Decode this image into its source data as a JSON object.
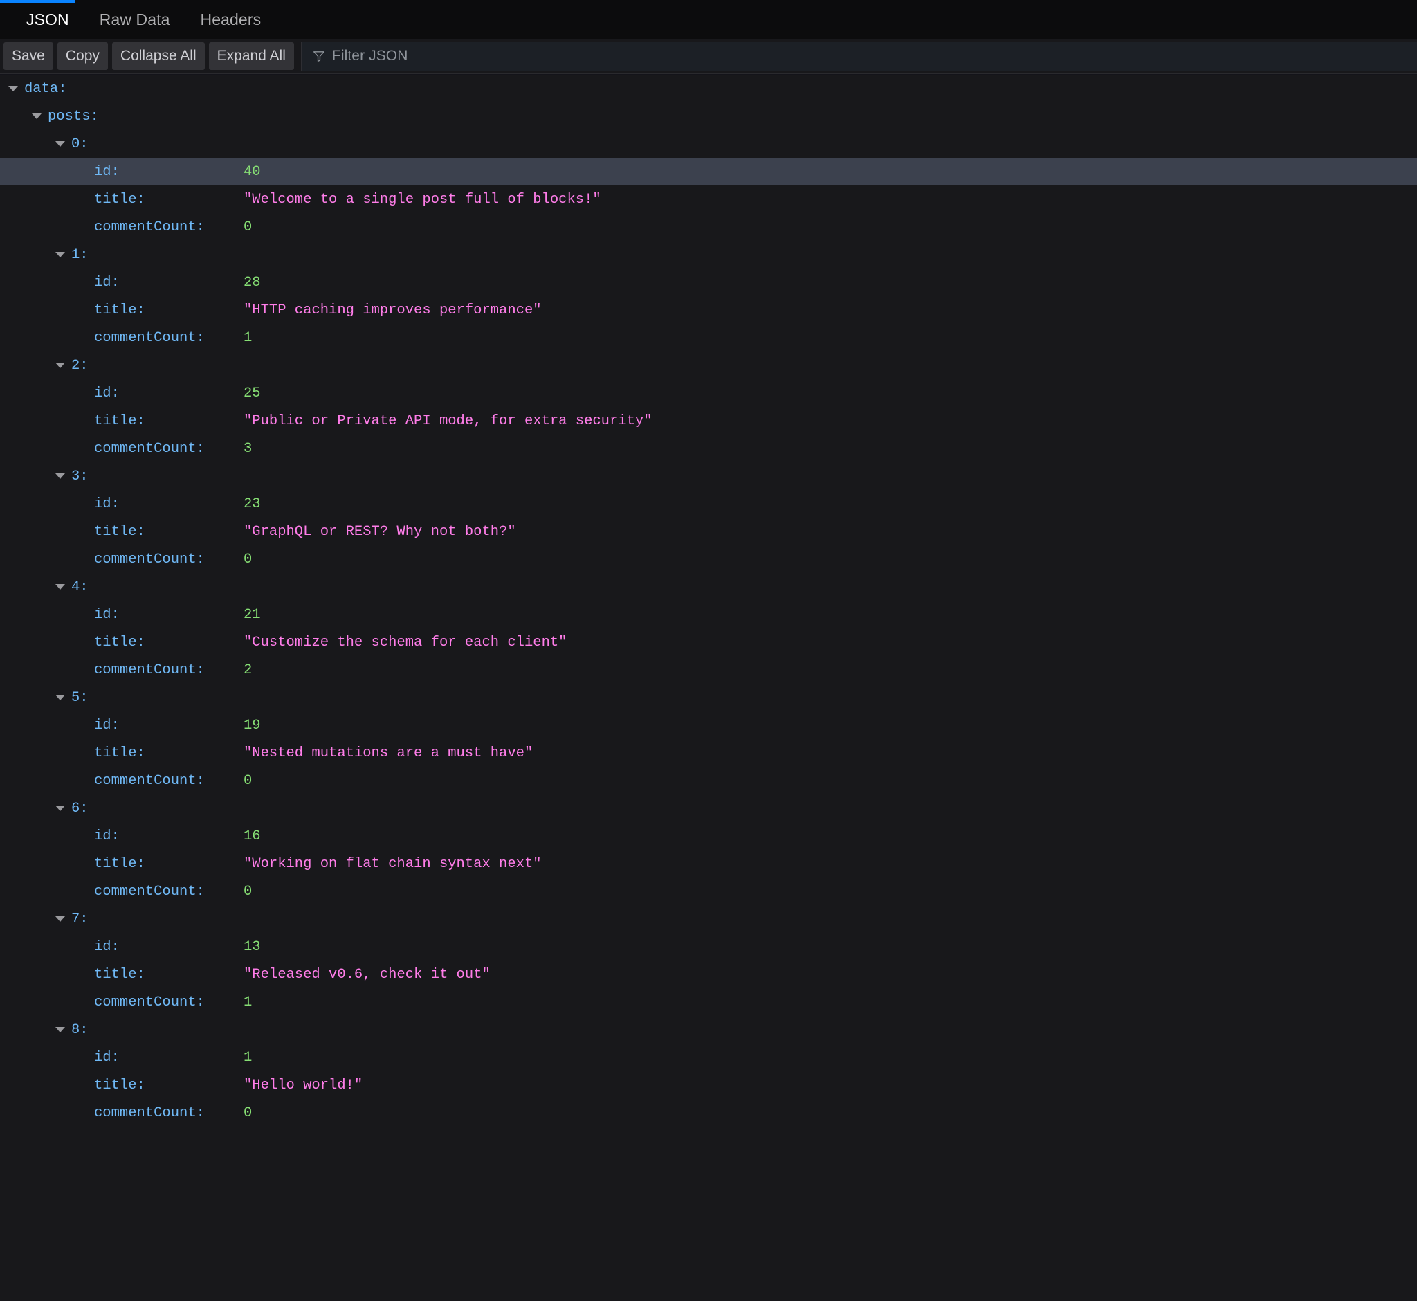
{
  "window": {
    "accent_color": "#0a84ff",
    "background": "#18181b"
  },
  "tabs": [
    {
      "label": "JSON",
      "active": true
    },
    {
      "label": "Raw Data",
      "active": false
    },
    {
      "label": "Headers",
      "active": false
    }
  ],
  "toolbar": {
    "save_label": "Save",
    "copy_label": "Copy",
    "collapse_all_label": "Collapse All",
    "expand_all_label": "Expand All",
    "filter_placeholder": "Filter JSON",
    "filter_icon": "filter-icon"
  },
  "json": {
    "root_key": "data:",
    "posts_key": "posts:",
    "keys": {
      "id": "id:",
      "title": "title:",
      "commentCount": "commentCount:"
    },
    "selected_row": "0.id",
    "posts": [
      {
        "index": "0:",
        "id": "40",
        "title": "\"Welcome to a single post full of blocks!\"",
        "commentCount": "0"
      },
      {
        "index": "1:",
        "id": "28",
        "title": "\"HTTP caching improves performance\"",
        "commentCount": "1"
      },
      {
        "index": "2:",
        "id": "25",
        "title": "\"Public or Private API mode, for extra security\"",
        "commentCount": "3"
      },
      {
        "index": "3:",
        "id": "23",
        "title": "\"GraphQL or REST? Why not both?\"",
        "commentCount": "0"
      },
      {
        "index": "4:",
        "id": "21",
        "title": "\"Customize the schema for each client\"",
        "commentCount": "2"
      },
      {
        "index": "5:",
        "id": "19",
        "title": "\"Nested mutations are a must have\"",
        "commentCount": "0"
      },
      {
        "index": "6:",
        "id": "16",
        "title": "\"Working on flat chain syntax next\"",
        "commentCount": "0"
      },
      {
        "index": "7:",
        "id": "13",
        "title": "\"Released v0.6, check it out\"",
        "commentCount": "1"
      },
      {
        "index": "8:",
        "id": "1",
        "title": "\"Hello world!\"",
        "commentCount": "0"
      }
    ]
  },
  "colors": {
    "key": "#6fb8f5",
    "number": "#86de74",
    "string": "#ff7de9",
    "selection": "#3c414e"
  }
}
